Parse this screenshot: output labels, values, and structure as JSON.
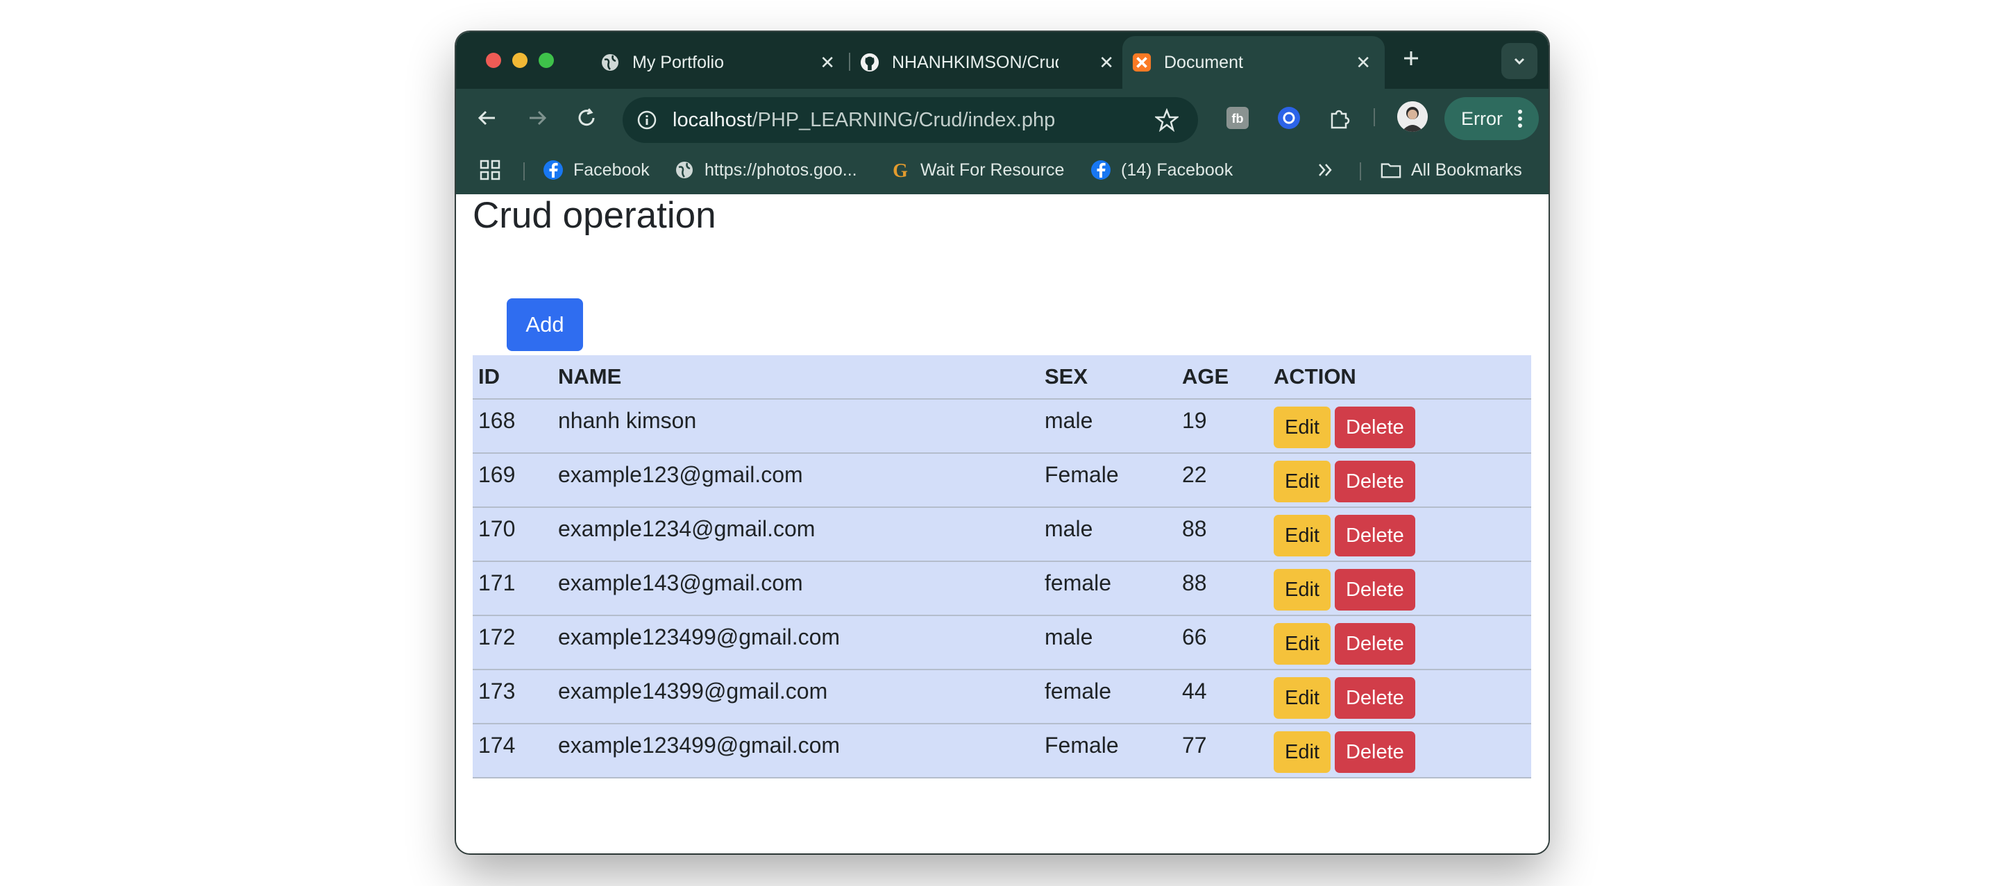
{
  "browser": {
    "tabs": [
      {
        "label": "My Portfolio",
        "icon": "globe-icon",
        "active": false
      },
      {
        "label": "NHANHKIMSON/Crud",
        "icon": "github-icon",
        "active": false
      },
      {
        "label": "Document",
        "icon": "xampp-icon",
        "active": true
      }
    ],
    "url_host": "localhost",
    "url_path": "/PHP_LEARNING/Crud/index.php",
    "status_chip": "Error",
    "bookmarks": [
      {
        "label": "Facebook",
        "icon": "facebook-icon"
      },
      {
        "label": "https://photos.goo...",
        "icon": "globe-icon"
      },
      {
        "label": "Wait For Resource",
        "icon": "g-icon"
      },
      {
        "label": "(14) Facebook",
        "icon": "facebook-icon"
      }
    ],
    "all_bookmarks": "All Bookmarks"
  },
  "page": {
    "title": "Crud operation",
    "add_label": "Add",
    "columns": [
      "ID",
      "NAME",
      "SEX",
      "AGE",
      "ACTION"
    ],
    "rows": [
      {
        "id": "168",
        "name": "nhanh kimson",
        "sex": "male",
        "age": "19"
      },
      {
        "id": "169",
        "name": "example123@gmail.com",
        "sex": "Female",
        "age": "22"
      },
      {
        "id": "170",
        "name": "example1234@gmail.com",
        "sex": "male",
        "age": "88"
      },
      {
        "id": "171",
        "name": "example143@gmail.com",
        "sex": "female",
        "age": "88"
      },
      {
        "id": "172",
        "name": "example123499@gmail.com",
        "sex": "male",
        "age": "66"
      },
      {
        "id": "173",
        "name": "example14399@gmail.com",
        "sex": "female",
        "age": "44"
      },
      {
        "id": "174",
        "name": "example123499@gmail.com",
        "sex": "Female",
        "age": "77"
      }
    ],
    "edit_label": "Edit",
    "delete_label": "Delete"
  },
  "colors": {
    "add_button": "#2f6df0",
    "edit_button": "#f5c23b",
    "delete_button": "#d13d49",
    "table_bg": "#d3def9",
    "browser_frame": "#244540"
  }
}
